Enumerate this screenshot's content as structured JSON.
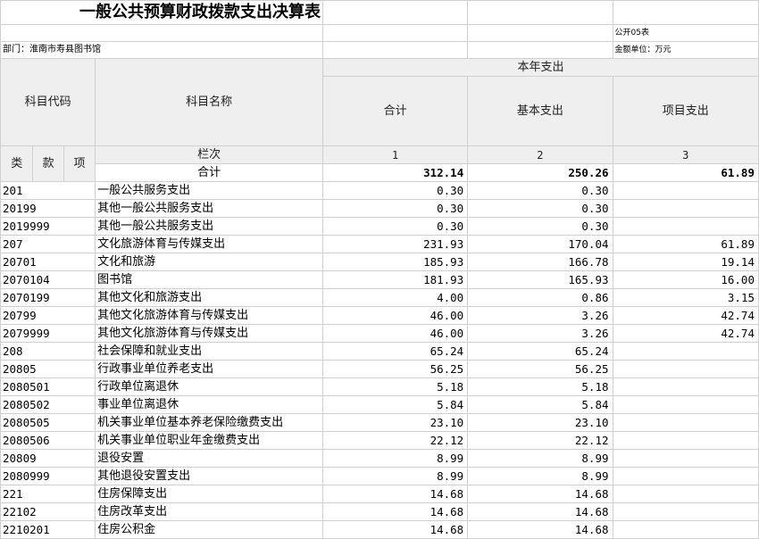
{
  "title": "一般公共预算财政拨款支出决算表",
  "form_code": "公开05表",
  "department": "部门：淮南市寿县图书馆",
  "unit": "金额单位：万元",
  "headers": {
    "current_year_expense": "本年支出",
    "subject_code": "科目代码",
    "subject_name": "科目名称",
    "total": "合计",
    "basic": "基本支出",
    "project": "项目支出",
    "lei": "类",
    "kuan": "款",
    "xiang": "项",
    "column_index": "栏次",
    "col1": "1",
    "col2": "2",
    "col3": "3"
  },
  "total_row": {
    "label": "合计",
    "total": "312.14",
    "basic": "250.26",
    "project": "61.89"
  },
  "rows": [
    {
      "code": "201",
      "name": "一般公共服务支出",
      "total": "0.30",
      "basic": "0.30",
      "project": ""
    },
    {
      "code": "20199",
      "name": "其他一般公共服务支出",
      "total": "0.30",
      "basic": "0.30",
      "project": ""
    },
    {
      "code": "2019999",
      "name": "其他一般公共服务支出",
      "total": "0.30",
      "basic": "0.30",
      "project": ""
    },
    {
      "code": "207",
      "name": "文化旅游体育与传媒支出",
      "total": "231.93",
      "basic": "170.04",
      "project": "61.89"
    },
    {
      "code": "20701",
      "name": "文化和旅游",
      "total": "185.93",
      "basic": "166.78",
      "project": "19.14"
    },
    {
      "code": "2070104",
      "name": "图书馆",
      "total": "181.93",
      "basic": "165.93",
      "project": "16.00"
    },
    {
      "code": "2070199",
      "name": "其他文化和旅游支出",
      "total": "4.00",
      "basic": "0.86",
      "project": "3.15"
    },
    {
      "code": "20799",
      "name": "其他文化旅游体育与传媒支出",
      "total": "46.00",
      "basic": "3.26",
      "project": "42.74"
    },
    {
      "code": "2079999",
      "name": "其他文化旅游体育与传媒支出",
      "total": "46.00",
      "basic": "3.26",
      "project": "42.74"
    },
    {
      "code": "208",
      "name": "社会保障和就业支出",
      "total": "65.24",
      "basic": "65.24",
      "project": ""
    },
    {
      "code": "20805",
      "name": "行政事业单位养老支出",
      "total": "56.25",
      "basic": "56.25",
      "project": ""
    },
    {
      "code": "2080501",
      "name": "行政单位离退休",
      "total": "5.18",
      "basic": "5.18",
      "project": ""
    },
    {
      "code": "2080502",
      "name": "事业单位离退休",
      "total": "5.84",
      "basic": "5.84",
      "project": ""
    },
    {
      "code": "2080505",
      "name": "机关事业单位基本养老保险缴费支出",
      "total": "23.10",
      "basic": "23.10",
      "project": ""
    },
    {
      "code": "2080506",
      "name": "机关事业单位职业年金缴费支出",
      "total": "22.12",
      "basic": "22.12",
      "project": ""
    },
    {
      "code": "20809",
      "name": "退役安置",
      "total": "8.99",
      "basic": "8.99",
      "project": ""
    },
    {
      "code": "2080999",
      "name": "其他退役安置支出",
      "total": "8.99",
      "basic": "8.99",
      "project": ""
    },
    {
      "code": "221",
      "name": "住房保障支出",
      "total": "14.68",
      "basic": "14.68",
      "project": ""
    },
    {
      "code": "22102",
      "name": "住房改革支出",
      "total": "14.68",
      "basic": "14.68",
      "project": ""
    },
    {
      "code": "2210201",
      "name": "住房公积金",
      "total": "14.68",
      "basic": "14.68",
      "project": ""
    }
  ]
}
